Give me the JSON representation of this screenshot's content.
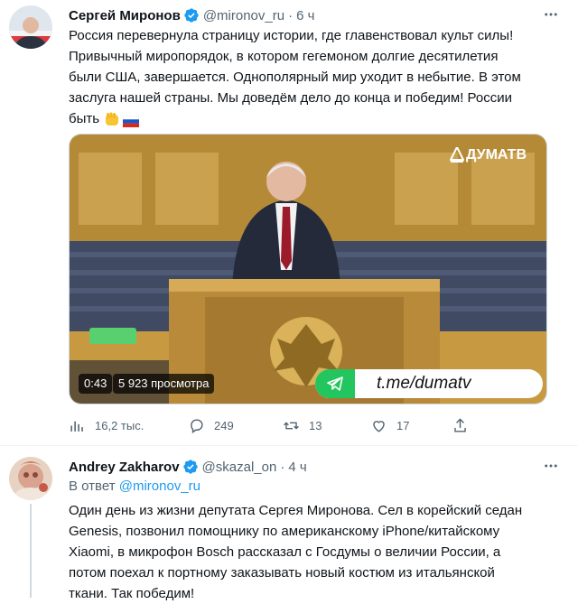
{
  "tweet1": {
    "name": "Сергей Миронов",
    "handle": "@mironov_ru",
    "time": "6 ч",
    "text_lines": [
      "Россия перевернула страницу истории, где главенствовал культ силы!",
      "Привычный миропорядок, в котором гегемоном долгие десятилетия",
      "были США, завершается. Однополярный мир уходит в небытие. В этом",
      "заслуга нашей страны. Мы доведём дело до конца и победим! России",
      "быть"
    ],
    "emoji": [
      "raised-fist",
      "flag-russia"
    ],
    "media": {
      "watermark": "ДУМАТВ",
      "duration": "0:43",
      "views": "5 923 просмотра",
      "channel_link": "t.me/dumatv"
    },
    "stats": {
      "views": "16,2 тыс.",
      "replies": "249",
      "retweets": "13",
      "likes": "17"
    }
  },
  "tweet2": {
    "name": "Andrey Zakharov",
    "handle": "@skazal_on",
    "time": "4 ч",
    "reply_prefix": "В ответ",
    "reply_handle": "@mironov_ru",
    "text_lines": [
      "Один день из жизни депутата Сергея Миронова. Сел в корейский седан",
      "Genesis, позвонил помощнику по американскому iPhone/китайскому",
      "Xiaomi, в микрофон Bosch рассказал с Госдумы о величии России, а",
      "потом поехал к портному заказывать новый костюм из итальянской",
      "ткани. Так победим!"
    ]
  },
  "colors": {
    "accent": "#1d9bf0",
    "muted": "#536471",
    "text": "#0f1419",
    "telegram_green": "#22c55e"
  }
}
